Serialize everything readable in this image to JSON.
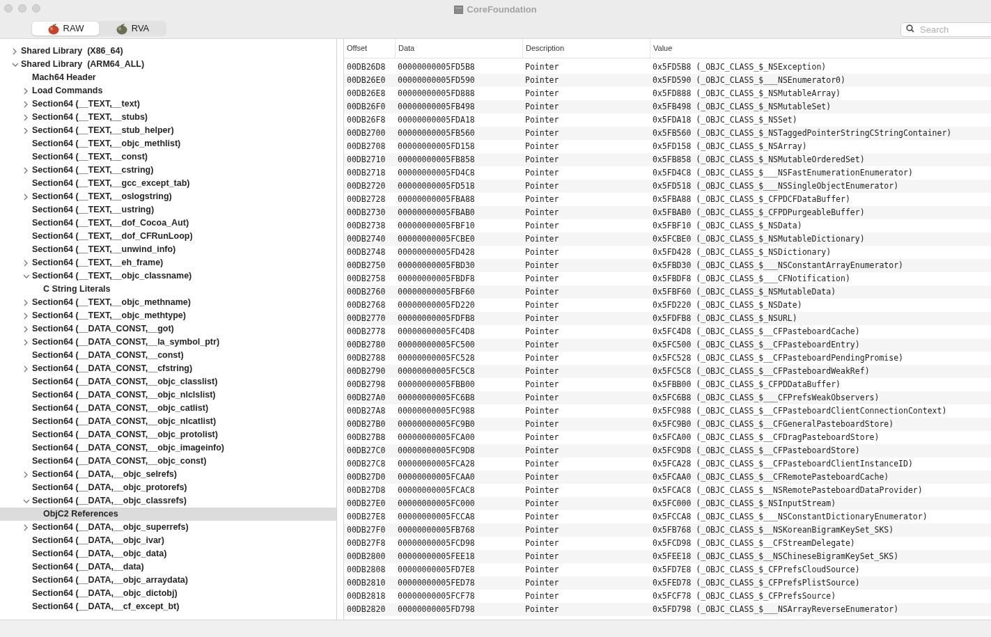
{
  "window": {
    "title": "CoreFoundation"
  },
  "modes": [
    {
      "label": "RAW",
      "selected": true
    },
    {
      "label": "RVA",
      "selected": false
    }
  ],
  "search": {
    "placeholder": "Search"
  },
  "tree": [
    {
      "label": "Shared Library  (X86_64)",
      "selected": false,
      "expanded": false
    },
    {
      "label": "Shared Library  (ARM64_ALL)",
      "selected": false,
      "expanded": true,
      "children": [
        {
          "label": "Mach64 Header",
          "selected": false
        },
        {
          "label": "Load Commands",
          "selected": false,
          "expanded": false
        },
        {
          "label": "Section64 (__TEXT,__text)",
          "selected": false,
          "expanded": false
        },
        {
          "label": "Section64 (__TEXT,__stubs)",
          "selected": false,
          "expanded": false
        },
        {
          "label": "Section64 (__TEXT,__stub_helper)",
          "selected": false,
          "expanded": false
        },
        {
          "label": "Section64 (__TEXT,__objc_methlist)",
          "selected": false
        },
        {
          "label": "Section64 (__TEXT,__const)",
          "selected": false
        },
        {
          "label": "Section64 (__TEXT,__cstring)",
          "selected": false,
          "expanded": false
        },
        {
          "label": "Section64 (__TEXT,__gcc_except_tab)",
          "selected": false
        },
        {
          "label": "Section64 (__TEXT,__oslogstring)",
          "selected": false,
          "expanded": false
        },
        {
          "label": "Section64 (__TEXT,__ustring)",
          "selected": false
        },
        {
          "label": "Section64 (__TEXT,__dof_Cocoa_Aut)",
          "selected": false
        },
        {
          "label": "Section64 (__TEXT,__dof_CFRunLoop)",
          "selected": false
        },
        {
          "label": "Section64 (__TEXT,__unwind_info)",
          "selected": false
        },
        {
          "label": "Section64 (__TEXT,__eh_frame)",
          "selected": false,
          "expanded": false
        },
        {
          "label": "Section64 (__TEXT,__objc_classname)",
          "selected": false,
          "expanded": true,
          "children": [
            {
              "label": "C String Literals",
              "selected": false
            }
          ]
        },
        {
          "label": "Section64 (__TEXT,__objc_methname)",
          "selected": false,
          "expanded": false
        },
        {
          "label": "Section64 (__TEXT,__objc_methtype)",
          "selected": false,
          "expanded": false
        },
        {
          "label": "Section64 (__DATA_CONST,__got)",
          "selected": false,
          "expanded": false
        },
        {
          "label": "Section64 (__DATA_CONST,__la_symbol_ptr)",
          "selected": false,
          "expanded": false
        },
        {
          "label": "Section64 (__DATA_CONST,__const)",
          "selected": false
        },
        {
          "label": "Section64 (__DATA_CONST,__cfstring)",
          "selected": false,
          "expanded": false
        },
        {
          "label": "Section64 (__DATA_CONST,__objc_classlist)",
          "selected": false
        },
        {
          "label": "Section64 (__DATA_CONST,__objc_nlclslist)",
          "selected": false
        },
        {
          "label": "Section64 (__DATA_CONST,__objc_catlist)",
          "selected": false
        },
        {
          "label": "Section64 (__DATA_CONST,__objc_nlcatlist)",
          "selected": false
        },
        {
          "label": "Section64 (__DATA_CONST,__objc_protolist)",
          "selected": false
        },
        {
          "label": "Section64 (__DATA_CONST,__objc_imageinfo)",
          "selected": false
        },
        {
          "label": "Section64 (__DATA_CONST,__objc_const)",
          "selected": false
        },
        {
          "label": "Section64 (__DATA,__objc_selrefs)",
          "selected": false,
          "expanded": false
        },
        {
          "label": "Section64 (__DATA,__objc_protorefs)",
          "selected": false
        },
        {
          "label": "Section64 (__DATA,__objc_classrefs)",
          "selected": false,
          "expanded": true,
          "children": [
            {
              "label": "ObjC2 References",
              "selected": true
            }
          ]
        },
        {
          "label": "Section64 (__DATA,__objc_superrefs)",
          "selected": false,
          "expanded": false
        },
        {
          "label": "Section64 (__DATA,__objc_ivar)",
          "selected": false
        },
        {
          "label": "Section64 (__DATA,__objc_data)",
          "selected": false
        },
        {
          "label": "Section64 (__DATA,__data)",
          "selected": false
        },
        {
          "label": "Section64 (__DATA,__objc_arraydata)",
          "selected": false
        },
        {
          "label": "Section64 (__DATA,__objc_dictobj)",
          "selected": false
        },
        {
          "label": "Section64 (__DATA,__cf_except_bt)",
          "selected": false
        }
      ]
    }
  ],
  "table": {
    "columns": [
      "Offset",
      "Data",
      "Description",
      "Value"
    ],
    "rows": [
      [
        "00DB26D8",
        "00000000005FD5B8",
        "Pointer",
        "0x5FD5B8 (_OBJC_CLASS_$_NSException)"
      ],
      [
        "00DB26E0",
        "00000000005FD590",
        "Pointer",
        "0x5FD590 (_OBJC_CLASS_$___NSEnumerator0)"
      ],
      [
        "00DB26E8",
        "00000000005FD888",
        "Pointer",
        "0x5FD888 (_OBJC_CLASS_$_NSMutableArray)"
      ],
      [
        "00DB26F0",
        "00000000005FB498",
        "Pointer",
        "0x5FB498 (_OBJC_CLASS_$_NSMutableSet)"
      ],
      [
        "00DB26F8",
        "00000000005FDA18",
        "Pointer",
        "0x5FDA18 (_OBJC_CLASS_$_NSSet)"
      ],
      [
        "00DB2700",
        "00000000005FB560",
        "Pointer",
        "0x5FB560 (_OBJC_CLASS_$_NSTaggedPointerStringCStringContainer)"
      ],
      [
        "00DB2708",
        "00000000005FD158",
        "Pointer",
        "0x5FD158 (_OBJC_CLASS_$_NSArray)"
      ],
      [
        "00DB2710",
        "00000000005FB858",
        "Pointer",
        "0x5FB858 (_OBJC_CLASS_$_NSMutableOrderedSet)"
      ],
      [
        "00DB2718",
        "00000000005FD4C8",
        "Pointer",
        "0x5FD4C8 (_OBJC_CLASS_$___NSFastEnumerationEnumerator)"
      ],
      [
        "00DB2720",
        "00000000005FD518",
        "Pointer",
        "0x5FD518 (_OBJC_CLASS_$___NSSingleObjectEnumerator)"
      ],
      [
        "00DB2728",
        "00000000005FBA88",
        "Pointer",
        "0x5FBA88 (_OBJC_CLASS_$_CFPDCFDataBuffer)"
      ],
      [
        "00DB2730",
        "00000000005FBAB0",
        "Pointer",
        "0x5FBAB0 (_OBJC_CLASS_$_CFPDPurgeableBuffer)"
      ],
      [
        "00DB2738",
        "00000000005FBF10",
        "Pointer",
        "0x5FBF10 (_OBJC_CLASS_$_NSData)"
      ],
      [
        "00DB2740",
        "00000000005FCBE0",
        "Pointer",
        "0x5FCBE0 (_OBJC_CLASS_$_NSMutableDictionary)"
      ],
      [
        "00DB2748",
        "00000000005FD428",
        "Pointer",
        "0x5FD428 (_OBJC_CLASS_$_NSDictionary)"
      ],
      [
        "00DB2750",
        "00000000005FBD30",
        "Pointer",
        "0x5FBD30 (_OBJC_CLASS_$___NSConstantArrayEnumerator)"
      ],
      [
        "00DB2758",
        "00000000005FBDF8",
        "Pointer",
        "0x5FBDF8 (_OBJC_CLASS_$___CFNotification)"
      ],
      [
        "00DB2760",
        "00000000005FBF60",
        "Pointer",
        "0x5FBF60 (_OBJC_CLASS_$_NSMutableData)"
      ],
      [
        "00DB2768",
        "00000000005FD220",
        "Pointer",
        "0x5FD220 (_OBJC_CLASS_$_NSDate)"
      ],
      [
        "00DB2770",
        "00000000005FDFB8",
        "Pointer",
        "0x5FDFB8 (_OBJC_CLASS_$_NSURL)"
      ],
      [
        "00DB2778",
        "00000000005FC4D8",
        "Pointer",
        "0x5FC4D8 (_OBJC_CLASS_$__CFPasteboardCache)"
      ],
      [
        "00DB2780",
        "00000000005FC500",
        "Pointer",
        "0x5FC500 (_OBJC_CLASS_$__CFPasteboardEntry)"
      ],
      [
        "00DB2788",
        "00000000005FC528",
        "Pointer",
        "0x5FC528 (_OBJC_CLASS_$__CFPasteboardPendingPromise)"
      ],
      [
        "00DB2790",
        "00000000005FC5C8",
        "Pointer",
        "0x5FC5C8 (_OBJC_CLASS_$__CFPasteboardWeakRef)"
      ],
      [
        "00DB2798",
        "00000000005FBB00",
        "Pointer",
        "0x5FBB00 (_OBJC_CLASS_$_CFPDDataBuffer)"
      ],
      [
        "00DB27A0",
        "00000000005FC6B8",
        "Pointer",
        "0x5FC6B8 (_OBJC_CLASS_$___CFPrefsWeakObservers)"
      ],
      [
        "00DB27A8",
        "00000000005FC988",
        "Pointer",
        "0x5FC988 (_OBJC_CLASS_$__CFPasteboardClientConnectionContext)"
      ],
      [
        "00DB27B0",
        "00000000005FC9B0",
        "Pointer",
        "0x5FC9B0 (_OBJC_CLASS_$__CFGeneralPasteboardStore)"
      ],
      [
        "00DB27B8",
        "00000000005FCA00",
        "Pointer",
        "0x5FCA00 (_OBJC_CLASS_$__CFDragPasteboardStore)"
      ],
      [
        "00DB27C0",
        "00000000005FC9D8",
        "Pointer",
        "0x5FC9D8 (_OBJC_CLASS_$__CFPasteboardStore)"
      ],
      [
        "00DB27C8",
        "00000000005FCA28",
        "Pointer",
        "0x5FCA28 (_OBJC_CLASS_$__CFPasteboardClientInstanceID)"
      ],
      [
        "00DB27D0",
        "00000000005FCAA0",
        "Pointer",
        "0x5FCAA0 (_OBJC_CLASS_$__CFRemotePasteboardCache)"
      ],
      [
        "00DB27D8",
        "00000000005FCAC8",
        "Pointer",
        "0x5FCAC8 (_OBJC_CLASS_$__NSRemotePasteboardDataProvider)"
      ],
      [
        "00DB27E0",
        "00000000005FC000",
        "Pointer",
        "0x5FC000 (_OBJC_CLASS_$_NSInputStream)"
      ],
      [
        "00DB27E8",
        "00000000005FCCA8",
        "Pointer",
        "0x5FCCA8 (_OBJC_CLASS_$___NSConstantDictionaryEnumerator)"
      ],
      [
        "00DB27F0",
        "00000000005FB768",
        "Pointer",
        "0x5FB768 (_OBJC_CLASS_$__NSKoreanBigramKeySet_SKS)"
      ],
      [
        "00DB27F8",
        "00000000005FCD98",
        "Pointer",
        "0x5FCD98 (_OBJC_CLASS_$__CFStreamDelegate)"
      ],
      [
        "00DB2800",
        "00000000005FEE18",
        "Pointer",
        "0x5FEE18 (_OBJC_CLASS_$__NSChineseBigramKeySet_SKS)"
      ],
      [
        "00DB2808",
        "00000000005FD7E8",
        "Pointer",
        "0x5FD7E8 (_OBJC_CLASS_$_CFPrefsCloudSource)"
      ],
      [
        "00DB2810",
        "00000000005FED78",
        "Pointer",
        "0x5FED78 (_OBJC_CLASS_$_CFPrefsPlistSource)"
      ],
      [
        "00DB2818",
        "00000000005FCF78",
        "Pointer",
        "0x5FCF78 (_OBJC_CLASS_$_CFPrefsSource)"
      ],
      [
        "00DB2820",
        "00000000005FD798",
        "Pointer",
        "0x5FD798 (_OBJC_CLASS_$___NSArrayReverseEnumerator)"
      ]
    ]
  }
}
